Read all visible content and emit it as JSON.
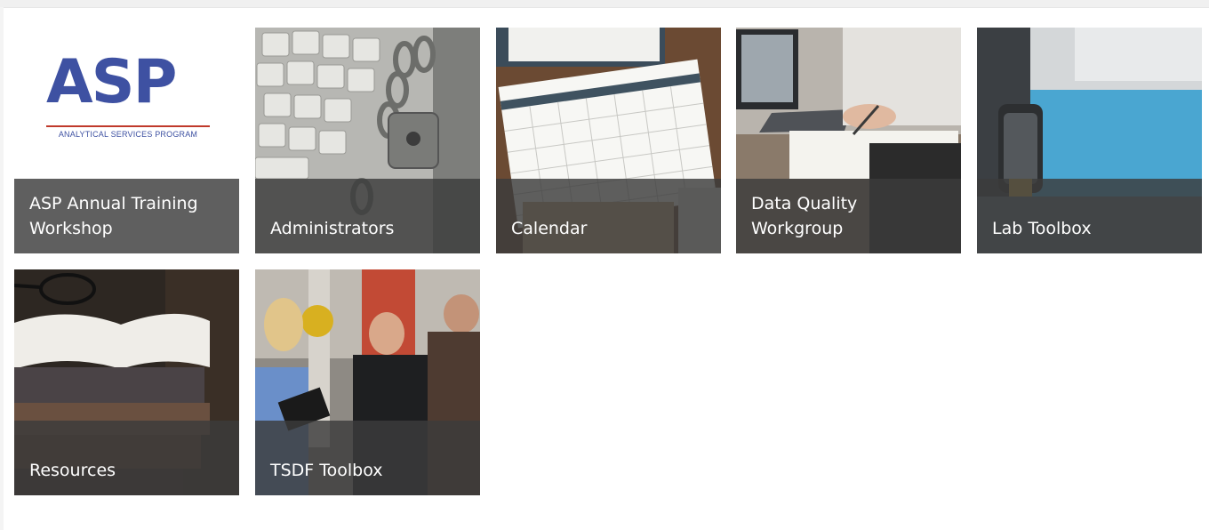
{
  "logo": {
    "mark": "ASP",
    "tagline": "ANALYTICAL SERVICES PROGRAM"
  },
  "tiles": [
    {
      "label": "ASP Annual Training Workshop"
    },
    {
      "label": "Administrators"
    },
    {
      "label": "Calendar"
    },
    {
      "label": "Data Quality Workgroup"
    },
    {
      "label": "Lab Toolbox"
    },
    {
      "label": "Resources"
    },
    {
      "label": "TSDF Toolbox"
    }
  ],
  "colors": {
    "logo_blue": "#3e51a2",
    "logo_red": "#c0392b",
    "caption_overlay": "#3c3c3c"
  },
  "icons": {
    "tile_1": "asp-logo-image",
    "tile_2": "keyboard-padlock-image",
    "tile_3": "calendar-image",
    "tile_4": "laptop-document-image",
    "tile_5": "microscope-image",
    "tile_6": "books-glasses-image",
    "tile_7": "field-inspectors-image"
  }
}
